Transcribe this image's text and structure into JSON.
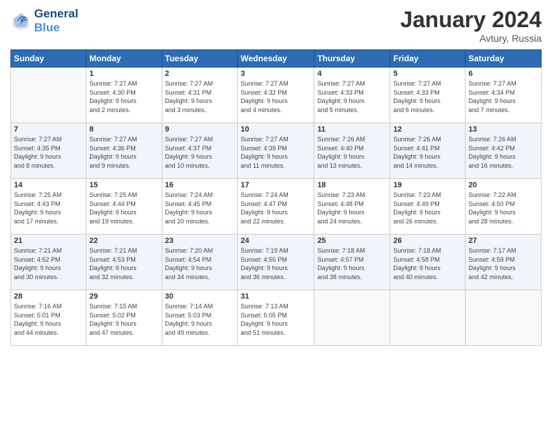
{
  "header": {
    "logo_line1": "General",
    "logo_line2": "Blue",
    "month_title": "January 2024",
    "location": "Avtury, Russia"
  },
  "weekdays": [
    "Sunday",
    "Monday",
    "Tuesday",
    "Wednesday",
    "Thursday",
    "Friday",
    "Saturday"
  ],
  "weeks": [
    [
      {
        "day": "",
        "info": ""
      },
      {
        "day": "1",
        "info": "Sunrise: 7:27 AM\nSunset: 4:30 PM\nDaylight: 9 hours\nand 2 minutes."
      },
      {
        "day": "2",
        "info": "Sunrise: 7:27 AM\nSunset: 4:31 PM\nDaylight: 9 hours\nand 3 minutes."
      },
      {
        "day": "3",
        "info": "Sunrise: 7:27 AM\nSunset: 4:32 PM\nDaylight: 9 hours\nand 4 minutes."
      },
      {
        "day": "4",
        "info": "Sunrise: 7:27 AM\nSunset: 4:33 PM\nDaylight: 9 hours\nand 5 minutes."
      },
      {
        "day": "5",
        "info": "Sunrise: 7:27 AM\nSunset: 4:33 PM\nDaylight: 9 hours\nand 6 minutes."
      },
      {
        "day": "6",
        "info": "Sunrise: 7:27 AM\nSunset: 4:34 PM\nDaylight: 9 hours\nand 7 minutes."
      }
    ],
    [
      {
        "day": "7",
        "info": "Sunrise: 7:27 AM\nSunset: 4:35 PM\nDaylight: 9 hours\nand 8 minutes."
      },
      {
        "day": "8",
        "info": "Sunrise: 7:27 AM\nSunset: 4:36 PM\nDaylight: 9 hours\nand 9 minutes."
      },
      {
        "day": "9",
        "info": "Sunrise: 7:27 AM\nSunset: 4:37 PM\nDaylight: 9 hours\nand 10 minutes."
      },
      {
        "day": "10",
        "info": "Sunrise: 7:27 AM\nSunset: 4:39 PM\nDaylight: 9 hours\nand 11 minutes."
      },
      {
        "day": "11",
        "info": "Sunrise: 7:26 AM\nSunset: 4:40 PM\nDaylight: 9 hours\nand 13 minutes."
      },
      {
        "day": "12",
        "info": "Sunrise: 7:26 AM\nSunset: 4:41 PM\nDaylight: 9 hours\nand 14 minutes."
      },
      {
        "day": "13",
        "info": "Sunrise: 7:26 AM\nSunset: 4:42 PM\nDaylight: 9 hours\nand 16 minutes."
      }
    ],
    [
      {
        "day": "14",
        "info": "Sunrise: 7:25 AM\nSunset: 4:43 PM\nDaylight: 9 hours\nand 17 minutes."
      },
      {
        "day": "15",
        "info": "Sunrise: 7:25 AM\nSunset: 4:44 PM\nDaylight: 9 hours\nand 19 minutes."
      },
      {
        "day": "16",
        "info": "Sunrise: 7:24 AM\nSunset: 4:45 PM\nDaylight: 9 hours\nand 20 minutes."
      },
      {
        "day": "17",
        "info": "Sunrise: 7:24 AM\nSunset: 4:47 PM\nDaylight: 9 hours\nand 22 minutes."
      },
      {
        "day": "18",
        "info": "Sunrise: 7:23 AM\nSunset: 4:48 PM\nDaylight: 9 hours\nand 24 minutes."
      },
      {
        "day": "19",
        "info": "Sunrise: 7:23 AM\nSunset: 4:49 PM\nDaylight: 9 hours\nand 26 minutes."
      },
      {
        "day": "20",
        "info": "Sunrise: 7:22 AM\nSunset: 4:50 PM\nDaylight: 9 hours\nand 28 minutes."
      }
    ],
    [
      {
        "day": "21",
        "info": "Sunrise: 7:21 AM\nSunset: 4:52 PM\nDaylight: 9 hours\nand 30 minutes."
      },
      {
        "day": "22",
        "info": "Sunrise: 7:21 AM\nSunset: 4:53 PM\nDaylight: 9 hours\nand 32 minutes."
      },
      {
        "day": "23",
        "info": "Sunrise: 7:20 AM\nSunset: 4:54 PM\nDaylight: 9 hours\nand 34 minutes."
      },
      {
        "day": "24",
        "info": "Sunrise: 7:19 AM\nSunset: 4:55 PM\nDaylight: 9 hours\nand 36 minutes."
      },
      {
        "day": "25",
        "info": "Sunrise: 7:18 AM\nSunset: 4:57 PM\nDaylight: 9 hours\nand 38 minutes."
      },
      {
        "day": "26",
        "info": "Sunrise: 7:18 AM\nSunset: 4:58 PM\nDaylight: 9 hours\nand 40 minutes."
      },
      {
        "day": "27",
        "info": "Sunrise: 7:17 AM\nSunset: 4:59 PM\nDaylight: 9 hours\nand 42 minutes."
      }
    ],
    [
      {
        "day": "28",
        "info": "Sunrise: 7:16 AM\nSunset: 5:01 PM\nDaylight: 9 hours\nand 44 minutes."
      },
      {
        "day": "29",
        "info": "Sunrise: 7:15 AM\nSunset: 5:02 PM\nDaylight: 9 hours\nand 47 minutes."
      },
      {
        "day": "30",
        "info": "Sunrise: 7:14 AM\nSunset: 5:03 PM\nDaylight: 9 hours\nand 49 minutes."
      },
      {
        "day": "31",
        "info": "Sunrise: 7:13 AM\nSunset: 5:05 PM\nDaylight: 9 hours\nand 51 minutes."
      },
      {
        "day": "",
        "info": ""
      },
      {
        "day": "",
        "info": ""
      },
      {
        "day": "",
        "info": ""
      }
    ]
  ]
}
